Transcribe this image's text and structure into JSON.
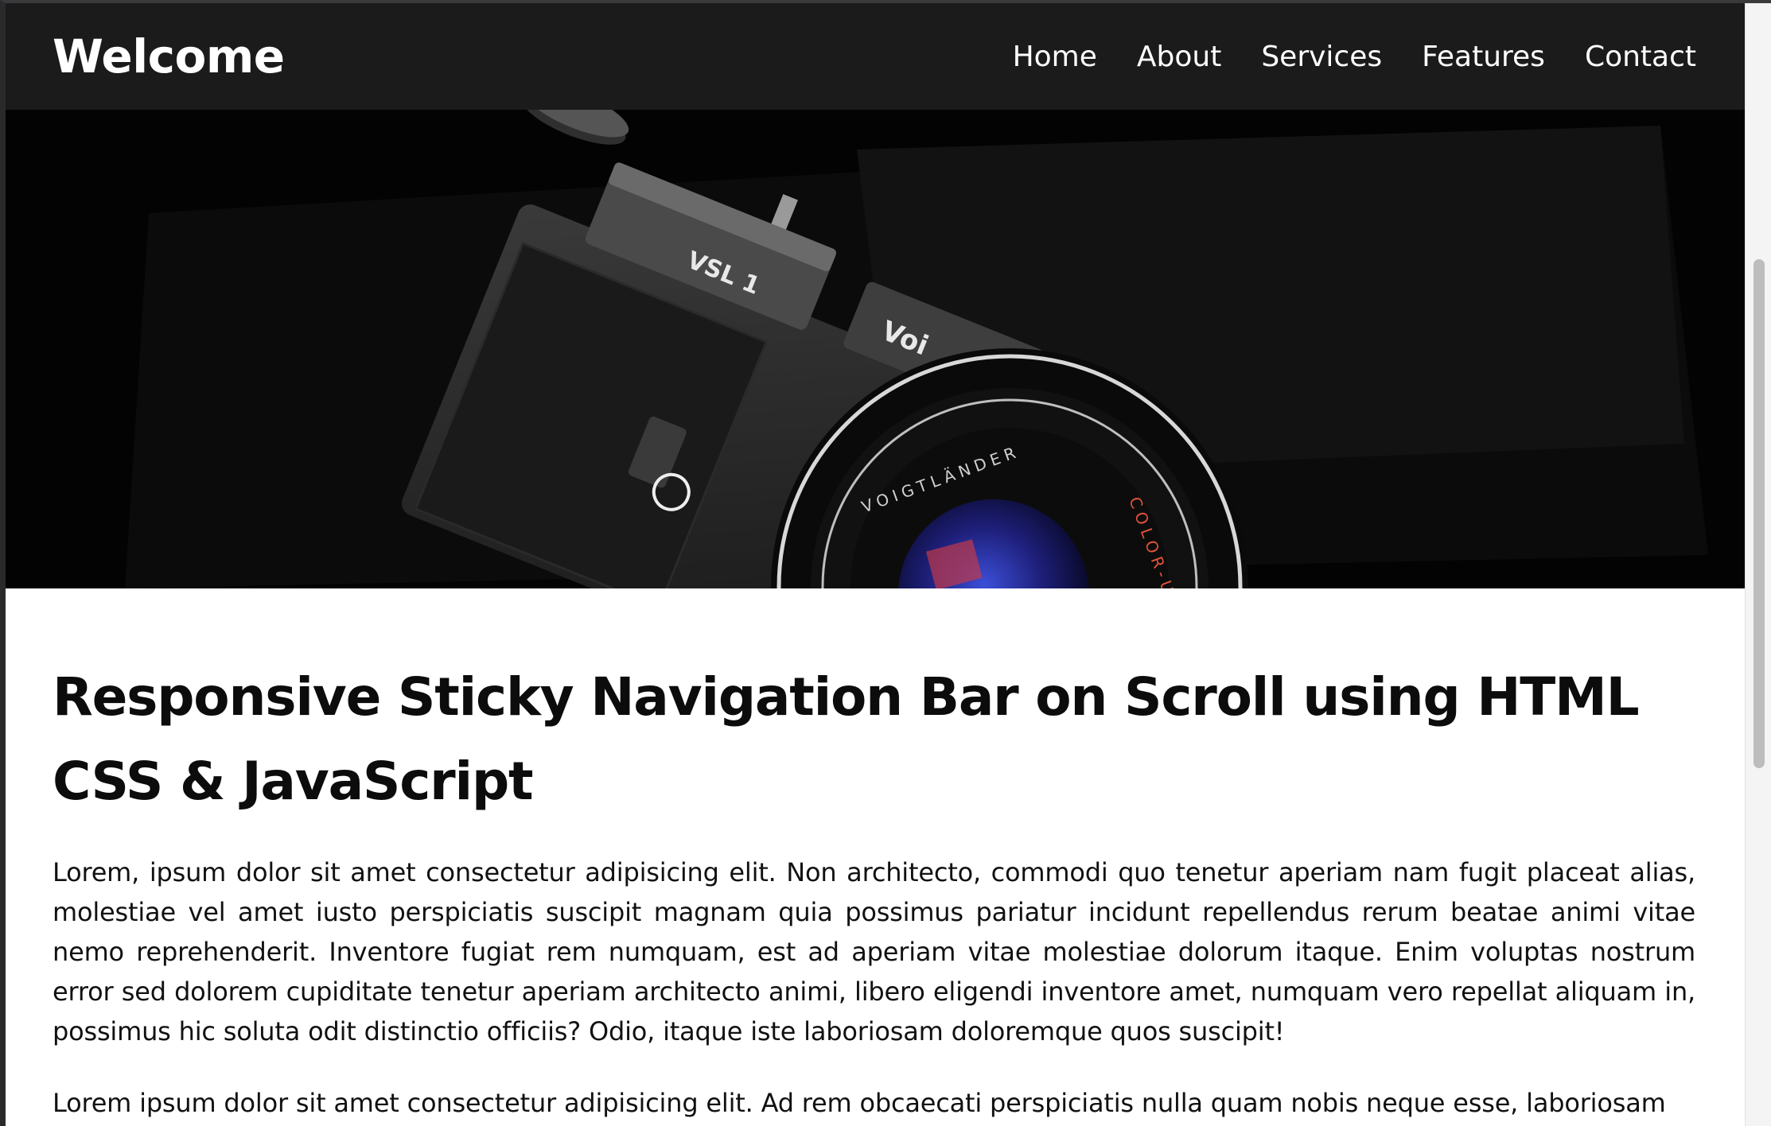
{
  "navbar": {
    "brand": "Welcome",
    "links": [
      "Home",
      "About",
      "Services",
      "Features",
      "Contact"
    ]
  },
  "hero": {
    "camera_model_text": "VSL 1",
    "brand_text": "Voi",
    "lens_brand_text": "VOIGTLÄNDER",
    "lens_color_text": "COLOR-U"
  },
  "main": {
    "title": "Responsive Sticky Navigation Bar on Scroll using HTML CSS & JavaScript",
    "paragraphs": [
      "Lorem, ipsum dolor sit amet consectetur adipisicing elit. Non architecto, commodi quo tenetur aperiam nam fugit placeat alias, molestiae vel amet iusto perspiciatis suscipit magnam quia possimus pariatur incidunt repellendus rerum beatae animi vitae nemo reprehenderit. Inventore fugiat rem numquam, est ad aperiam vitae molestiae dolorum itaque. Enim voluptas nostrum error sed dolorem cupiditate tenetur aperiam architecto animi, libero eligendi inventore amet, numquam vero repellat aliquam in, possimus hic soluta odit distinctio officiis? Odio, itaque iste laboriosam doloremque quos suscipit!",
      "Lorem ipsum dolor sit amet consectetur adipisicing elit. Ad rem obcaecati perspiciatis nulla quam nobis neque esse, laboriosam"
    ]
  },
  "colors": {
    "navbar_bg": "#1b1b1c",
    "hero_bg": "#000000",
    "lens_accent": "#e2533a"
  }
}
